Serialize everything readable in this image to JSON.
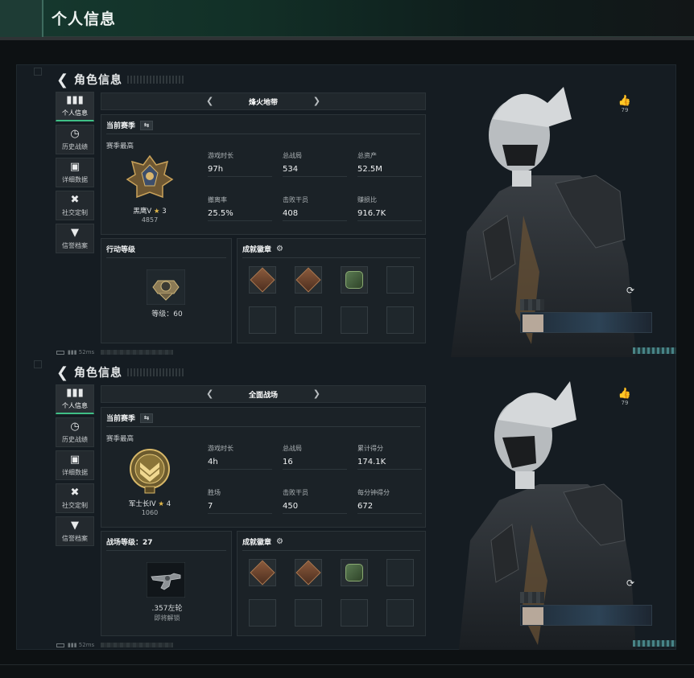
{
  "page_title": "个人信息",
  "panels": [
    {
      "header": "角色信息",
      "sidebar": [
        {
          "icon": "bar-chart-icon",
          "label": "个人信息",
          "active": true
        },
        {
          "icon": "history-icon",
          "label": "历史战绩"
        },
        {
          "icon": "folder-icon",
          "label": "详细数据"
        },
        {
          "icon": "tools-icon",
          "label": "社交定制"
        },
        {
          "icon": "shield-icon",
          "label": "信誉档案"
        }
      ],
      "mode": "烽火地带",
      "season_label": "当前赛季",
      "season_best": "赛季最高",
      "rank_name": "黑鹰V",
      "rank_stars": "3",
      "rank_score": "4857",
      "stats": [
        {
          "label": "游戏时长",
          "value": "97h"
        },
        {
          "label": "总战局",
          "value": "534"
        },
        {
          "label": "总资产",
          "value": "52.5M"
        },
        {
          "label": "撤离率",
          "value": "25.5%"
        },
        {
          "label": "击败干员",
          "value": "408"
        },
        {
          "label": "赚损比",
          "value": "916.7K"
        }
      ],
      "level_title": "行动等级",
      "level_line1": "等级：60",
      "level_line2": "",
      "badges_title": "成就徽章",
      "status_ping": "52ms",
      "likes": "79"
    },
    {
      "header": "角色信息",
      "sidebar": [
        {
          "icon": "bar-chart-icon",
          "label": "个人信息",
          "active": true
        },
        {
          "icon": "history-icon",
          "label": "历史战绩"
        },
        {
          "icon": "folder-icon",
          "label": "详细数据"
        },
        {
          "icon": "tools-icon",
          "label": "社交定制"
        },
        {
          "icon": "shield-icon",
          "label": "信誉档案"
        }
      ],
      "mode": "全面战场",
      "season_label": "当前赛季",
      "season_best": "赛季最高",
      "rank_name": "军士长IV",
      "rank_stars": "4",
      "rank_score": "1060",
      "stats": [
        {
          "label": "游戏时长",
          "value": "4h"
        },
        {
          "label": "总战局",
          "value": "16"
        },
        {
          "label": "累计得分",
          "value": "174.1K"
        },
        {
          "label": "胜场",
          "value": "7"
        },
        {
          "label": "击败干员",
          "value": "450"
        },
        {
          "label": "每分钟得分",
          "value": "672"
        }
      ],
      "level_title": "战场等级：27",
      "level_line1": ".357左轮",
      "level_line2": "即将解锁",
      "badges_title": "成就徽章",
      "status_ping": "52ms",
      "likes": "79"
    }
  ],
  "colors": {
    "accent_green": "#3fbf86",
    "star_gold": "#e2b84a"
  }
}
